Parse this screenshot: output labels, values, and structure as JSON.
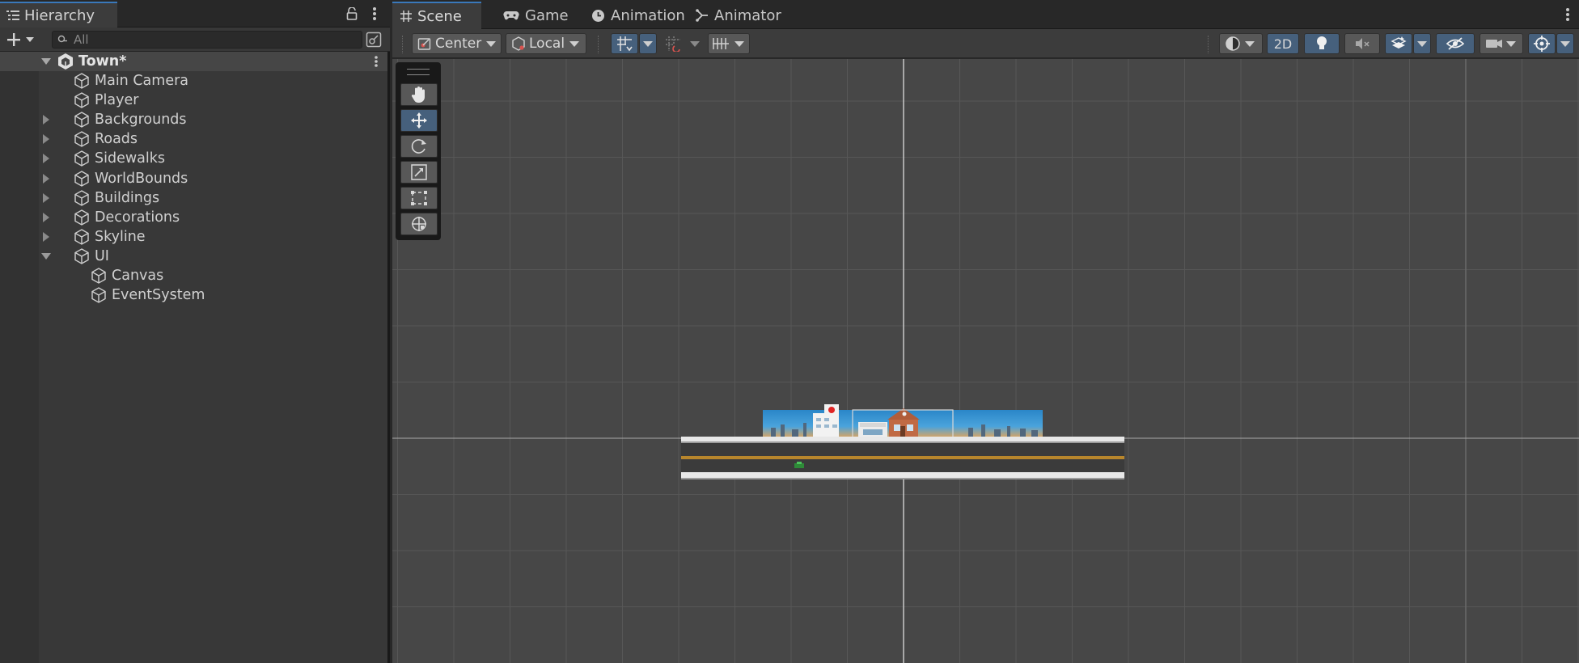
{
  "hierarchy": {
    "tab_label": "Hierarchy",
    "lock_icon": "lock-icon",
    "menu_icon": "kebab-menu-icon",
    "add_icon": "plus-icon",
    "search_placeholder": "All",
    "scene": {
      "name": "Town*"
    },
    "items": [
      {
        "label": "Main Camera",
        "indent": 1,
        "expandable": false
      },
      {
        "label": "Player",
        "indent": 1,
        "expandable": false
      },
      {
        "label": "Backgrounds",
        "indent": 1,
        "expandable": true,
        "expanded": false
      },
      {
        "label": "Roads",
        "indent": 1,
        "expandable": true,
        "expanded": false
      },
      {
        "label": "Sidewalks",
        "indent": 1,
        "expandable": true,
        "expanded": false
      },
      {
        "label": "WorldBounds",
        "indent": 1,
        "expandable": true,
        "expanded": false
      },
      {
        "label": "Buildings",
        "indent": 1,
        "expandable": true,
        "expanded": false
      },
      {
        "label": "Decorations",
        "indent": 1,
        "expandable": true,
        "expanded": false
      },
      {
        "label": "Skyline",
        "indent": 1,
        "expandable": true,
        "expanded": false
      },
      {
        "label": "UI",
        "indent": 1,
        "expandable": true,
        "expanded": true
      },
      {
        "label": "Canvas",
        "indent": 2,
        "expandable": false
      },
      {
        "label": "EventSystem",
        "indent": 2,
        "expandable": false
      }
    ]
  },
  "scene_view": {
    "tabs": [
      {
        "label": "Scene",
        "icon": "grid-hash-icon",
        "active": true
      },
      {
        "label": "Game",
        "icon": "gamepad-icon",
        "active": false
      },
      {
        "label": "Animation",
        "icon": "clock-icon",
        "active": false
      },
      {
        "label": "Animator",
        "icon": "animator-icon",
        "active": false
      }
    ],
    "toolbar": {
      "pivot_label": "Center",
      "space_label": "Local",
      "mode_2d_label": "2D"
    },
    "tools": [
      "hand-tool-icon",
      "move-tool-icon",
      "rotate-tool-icon",
      "scale-tool-icon",
      "rect-tool-icon",
      "transform-tool-icon"
    ],
    "selected_tool": "move-tool-icon"
  },
  "colors": {
    "accent_blue": "#46607c",
    "tab_highlight": "#3a79bb",
    "panel_bg": "#383838",
    "viewport_bg": "#474747"
  }
}
